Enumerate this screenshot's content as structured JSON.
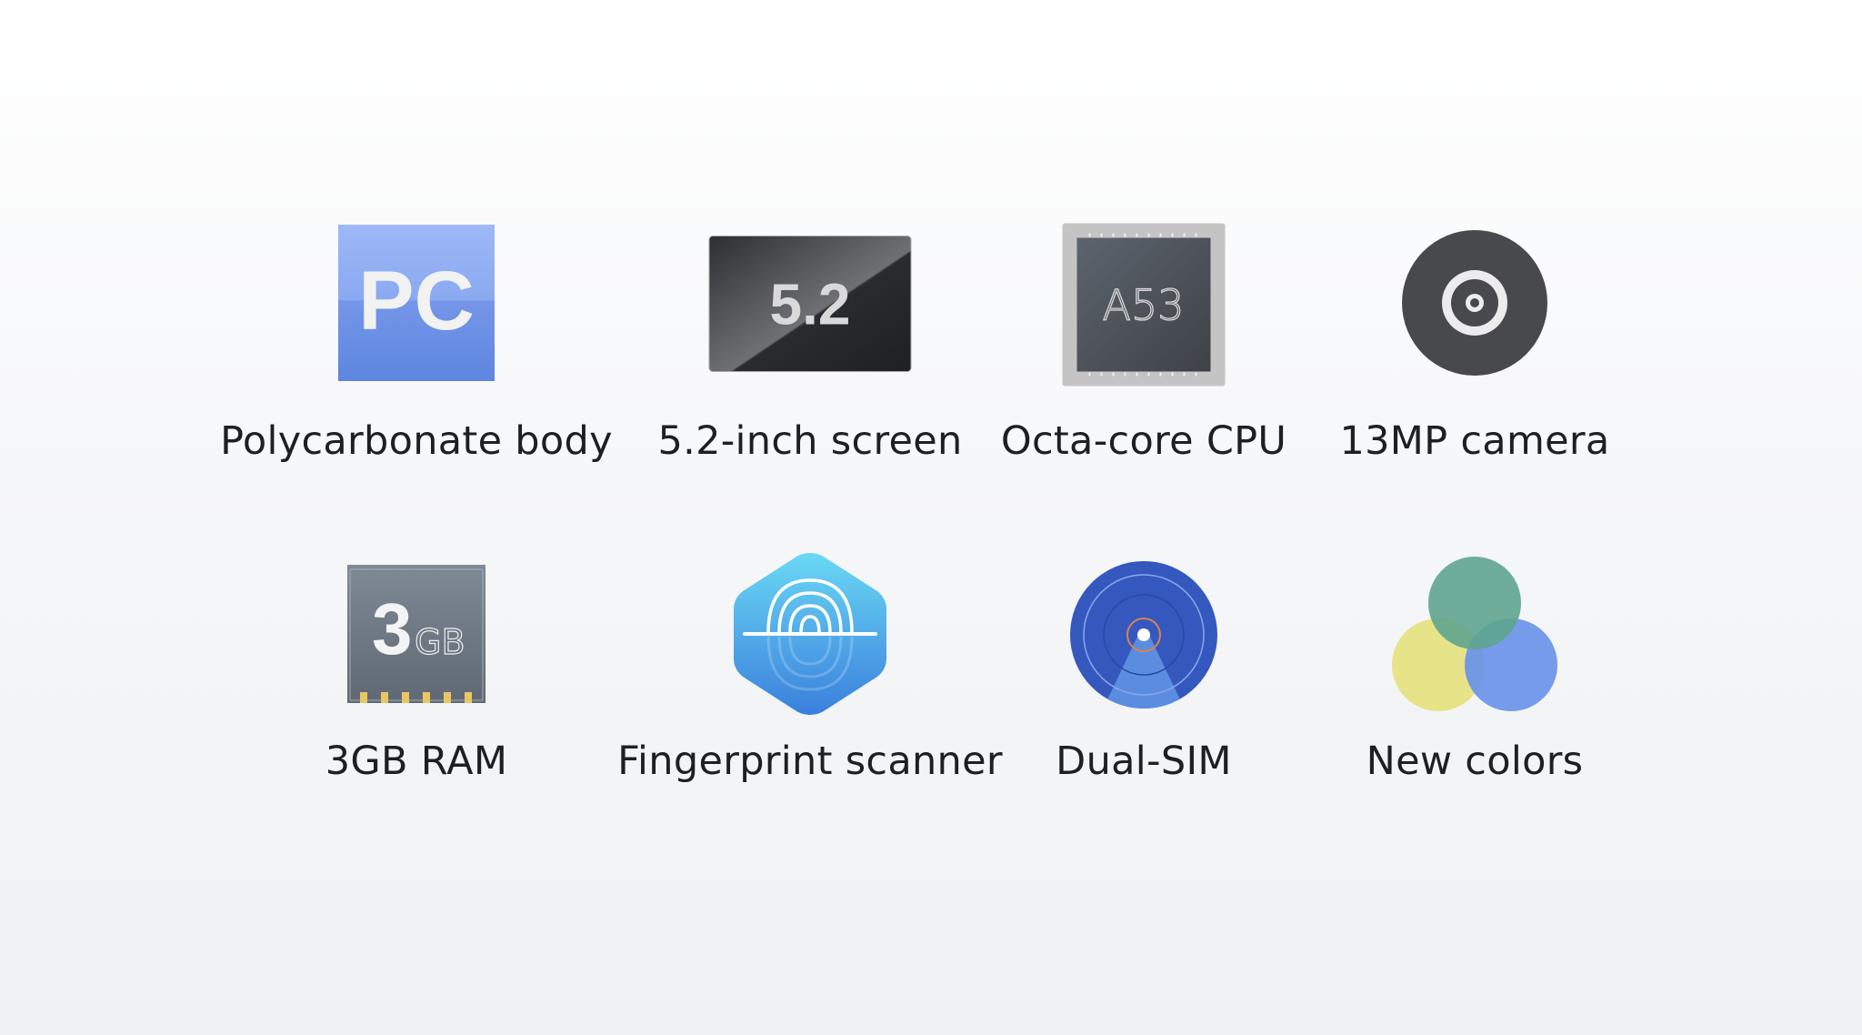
{
  "features": [
    {
      "label": "Polycarbonate body",
      "icon": "polycarbonate-pc-icon",
      "icon_text": "PC"
    },
    {
      "label": "5.2-inch screen",
      "icon": "screen-icon",
      "icon_text": "5.2"
    },
    {
      "label": "Octa-core CPU",
      "icon": "cpu-chip-icon",
      "icon_text": "A53"
    },
    {
      "label": "13MP camera",
      "icon": "camera-lens-icon"
    },
    {
      "label": "3GB RAM",
      "icon": "ram-chip-icon",
      "icon_text": "3",
      "icon_subtext": "GB"
    },
    {
      "label": "Fingerprint scanner",
      "icon": "fingerprint-icon"
    },
    {
      "label": "Dual-SIM",
      "icon": "dual-sim-signal-icon"
    },
    {
      "label": "New colors",
      "icon": "color-circles-icon"
    }
  ],
  "colors": {
    "green": "#5ea58e",
    "yellow": "#e6e282",
    "blue": "#6a93e8"
  }
}
